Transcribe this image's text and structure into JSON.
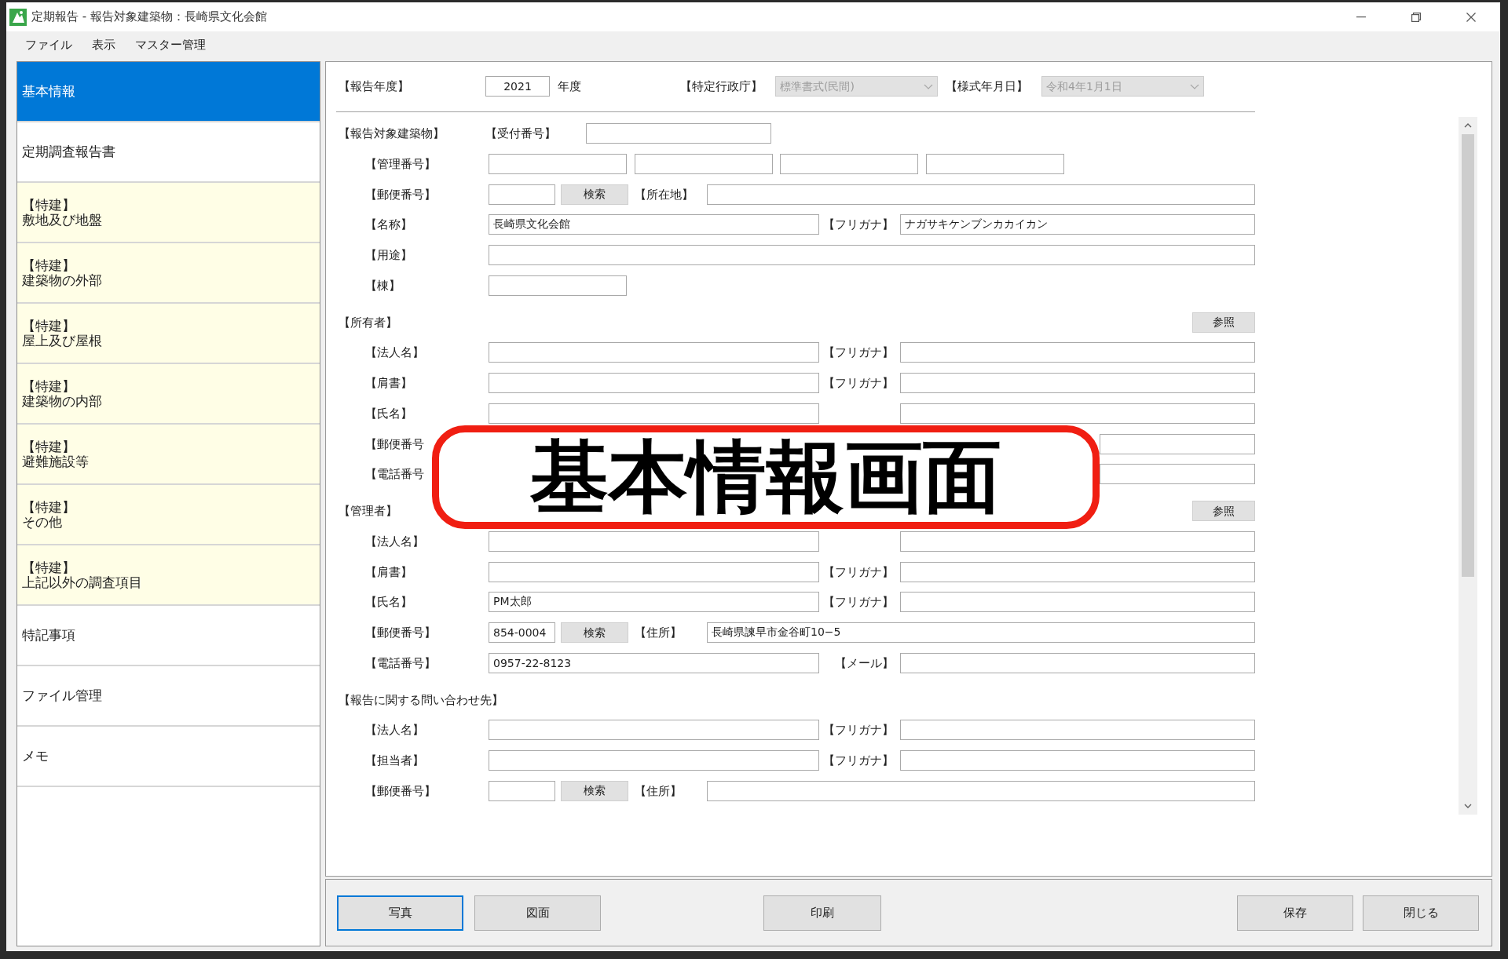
{
  "window": {
    "title": "定期報告 - 報告対象建築物：長崎県文化会館"
  },
  "menu": [
    "ファイル",
    "表示",
    "マスター管理"
  ],
  "sidebar": {
    "items": [
      {
        "kind": "plain",
        "label": "基本情報",
        "selected": true
      },
      {
        "kind": "plain",
        "label": "定期調査報告書",
        "selected": false
      },
      {
        "kind": "tagged",
        "tag": "【特建】",
        "label": "敷地及び地盤",
        "selected": false
      },
      {
        "kind": "tagged",
        "tag": "【特建】",
        "label": "建築物の外部",
        "selected": false
      },
      {
        "kind": "tagged",
        "tag": "【特建】",
        "label": "屋上及び屋根",
        "selected": false
      },
      {
        "kind": "tagged",
        "tag": "【特建】",
        "label": "建築物の内部",
        "selected": false
      },
      {
        "kind": "tagged",
        "tag": "【特建】",
        "label": "避難施設等",
        "selected": false
      },
      {
        "kind": "tagged",
        "tag": "【特建】",
        "label": "その他",
        "selected": false
      },
      {
        "kind": "tagged",
        "tag": "【特建】",
        "label": "上記以外の調査項目",
        "selected": false
      },
      {
        "kind": "plain",
        "label": "特記事項",
        "selected": false
      },
      {
        "kind": "plain",
        "label": "ファイル管理",
        "selected": false
      },
      {
        "kind": "plain",
        "label": "メモ",
        "selected": false
      }
    ]
  },
  "header": {
    "year_label": "【報告年度】",
    "year": "2021",
    "year_suffix": "年度",
    "authority_label": "【特定行政庁】",
    "authority": {
      "value": "標準書式(民間)",
      "disabled": true
    },
    "format_date_label": "【様式年月日】",
    "format_date": {
      "value": "令和4年1月1日",
      "disabled": true
    }
  },
  "sections": [
    {
      "title": "【報告対象建築物】",
      "receipt_label": "【受付番号】",
      "rows": [
        {
          "kind": "quad",
          "label": "【管理番号】"
        },
        {
          "kind": "postal",
          "label": "【郵便番号】",
          "button": "検索",
          "right_label": "【所在地】"
        },
        {
          "kind": "split",
          "label": "【名称】",
          "value": "長崎県文化会館",
          "right_label": "【フリガナ】",
          "right_value": "ナガサキケンブンカカイカン"
        },
        {
          "kind": "wide",
          "label": "【用途】"
        },
        {
          "kind": "short",
          "label": "【棟】"
        }
      ]
    },
    {
      "title": "【所有者】",
      "button": "参照",
      "rows": [
        {
          "kind": "split",
          "label": "【法人名】",
          "right_label": "【フリガナ】"
        },
        {
          "kind": "split",
          "label": "【肩書】",
          "right_label": "【フリガナ】"
        },
        {
          "kind": "split",
          "label": "【氏名】"
        },
        {
          "kind": "tail",
          "label": "【郵便番号"
        },
        {
          "kind": "tail",
          "label": "【電話番号"
        }
      ]
    },
    {
      "title": "【管理者】",
      "button": "参照",
      "rows": [
        {
          "kind": "split",
          "label": "【法人名】"
        },
        {
          "kind": "split",
          "label": "【肩書】",
          "right_label": "【フリガナ】"
        },
        {
          "kind": "split",
          "label": "【氏名】",
          "value": "PM太郎",
          "right_label": "【フリガナ】"
        },
        {
          "kind": "postal",
          "label": "【郵便番号】",
          "value": "854-0004",
          "button": "検索",
          "right_label": "【住所】",
          "right_value": "長崎県諫早市金谷町10−5"
        },
        {
          "kind": "split",
          "label": "【電話番号】",
          "value": "0957-22-8123",
          "right_label": "【メール】"
        }
      ]
    },
    {
      "title": "【報告に関する問い合わせ先】",
      "rows": [
        {
          "kind": "split",
          "label": "【法人名】",
          "right_label": "【フリガナ】"
        },
        {
          "kind": "split",
          "label": "【担当者】",
          "right_label": "【フリガナ】"
        },
        {
          "kind": "postal",
          "label": "【郵便番号】",
          "button": "検索",
          "right_label": "【住所】"
        }
      ]
    }
  ],
  "annotation": {
    "text": "基本情報画面"
  },
  "footer": {
    "left_buttons": [
      {
        "label": "写真",
        "focused": true
      },
      {
        "label": "図面",
        "focused": false
      }
    ],
    "center_buttons": [
      {
        "label": "印刷",
        "focused": false
      }
    ],
    "right_buttons": [
      {
        "label": "保存",
        "focused": false
      },
      {
        "label": "閉じる",
        "focused": false
      }
    ]
  }
}
